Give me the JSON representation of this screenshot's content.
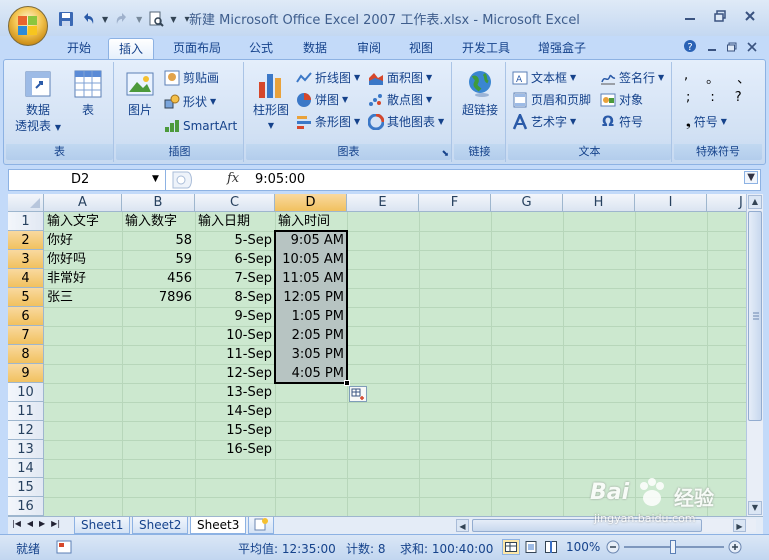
{
  "window": {
    "title": "新建 Microsoft Office Excel 2007 工作表.xlsx - Microsoft Excel"
  },
  "ribbon_tabs": [
    "开始",
    "插入",
    "页面布局",
    "公式",
    "数据",
    "审阅",
    "视图",
    "开发工具",
    "增强盒子"
  ],
  "active_tab": "插入",
  "ribbon": {
    "groups": {
      "table": {
        "label": "表",
        "pivot_line1": "数据",
        "pivot_line2": "透视表",
        "table_btn": "表"
      },
      "illustrations": {
        "label": "插图",
        "picture": "图片",
        "clipart": "剪贴画",
        "shapes": "形状",
        "smartart": "SmartArt"
      },
      "charts": {
        "label": "图表",
        "column": "柱形图",
        "line": "折线图",
        "pie": "饼图",
        "bar": "条形图",
        "area": "面积图",
        "scatter": "散点图",
        "other": "其他图表"
      },
      "links": {
        "label": "链接",
        "hyperlink": "超链接"
      },
      "text": {
        "label": "文本",
        "textbox": "文本框",
        "header_footer": "页眉和页脚",
        "wordart": "艺术字",
        "signature": "签名行",
        "object": "对象",
        "symbol": "符号"
      },
      "special": {
        "label": "特殊符号",
        "row1": [
          ",",
          "。",
          "、"
        ],
        "row2": [
          ";",
          ":",
          "?"
        ],
        "symbol": "符号"
      }
    }
  },
  "formula_bar": {
    "name_box": "D2",
    "fx": "fx",
    "value": "9:05:00"
  },
  "columns": [
    "A",
    "B",
    "C",
    "D",
    "E",
    "F",
    "G",
    "H",
    "I",
    "J"
  ],
  "rows": [
    "1",
    "2",
    "3",
    "4",
    "5",
    "6",
    "7",
    "8",
    "9",
    "10",
    "11",
    "12",
    "13",
    "14",
    "15",
    "16"
  ],
  "cells": {
    "A1": "输入文字",
    "B1": "输入数字",
    "C1": "输入日期",
    "D1": "输入时间",
    "A2": "你好",
    "B2": "58",
    "C2": "5-Sep",
    "D2": "9:05 AM",
    "A3": "你好吗",
    "B3": "59",
    "C3": "6-Sep",
    "D3": "10:05 AM",
    "A4": "非常好",
    "B4": "456",
    "C4": "7-Sep",
    "D4": "11:05 AM",
    "A5": "张三",
    "B5": "7896",
    "C5": "8-Sep",
    "D5": "12:05 PM",
    "C6": "9-Sep",
    "D6": "1:05 PM",
    "C7": "10-Sep",
    "D7": "2:05 PM",
    "C8": "11-Sep",
    "D8": "3:05 PM",
    "C9": "12-Sep",
    "D9": "4:05 PM",
    "C10": "13-Sep",
    "C11": "14-Sep",
    "C12": "15-Sep",
    "C13": "16-Sep"
  },
  "sheets": [
    "Sheet1",
    "Sheet2",
    "Sheet3"
  ],
  "active_sheet": "Sheet3",
  "status": {
    "ready": "就绪",
    "average": "平均值: 12:35:00",
    "count": "计数: 8",
    "sum": "求和: 100:40:00",
    "zoom": "100%"
  },
  "watermark": {
    "brand": "Bai",
    "brand2": "经验",
    "url": "jingyan.baidu.com"
  },
  "colors": {
    "grid_background": "#cce8cf",
    "selection_fill": "#b7c4c2",
    "header_selected": "#f1c15f",
    "ribbon_text": "#15428b"
  }
}
